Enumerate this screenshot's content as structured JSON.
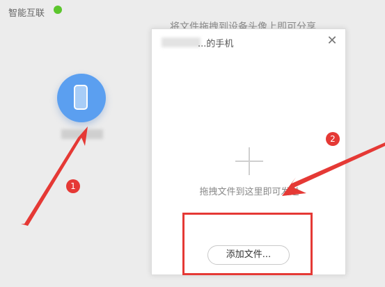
{
  "app": {
    "title": "智能互联",
    "status_color": "#5cc62d"
  },
  "share_hint": "将文件拖拽到设备头像上即可分享",
  "device": {
    "icon": "phone-icon",
    "color": "#5b9ff0"
  },
  "dialog": {
    "title": "...的手机",
    "drop_hint": "拖拽文件到这里即可发送",
    "add_file_label": "添加文件..."
  },
  "annotations": {
    "step1": "1",
    "step2": "2",
    "color": "#e53935"
  }
}
